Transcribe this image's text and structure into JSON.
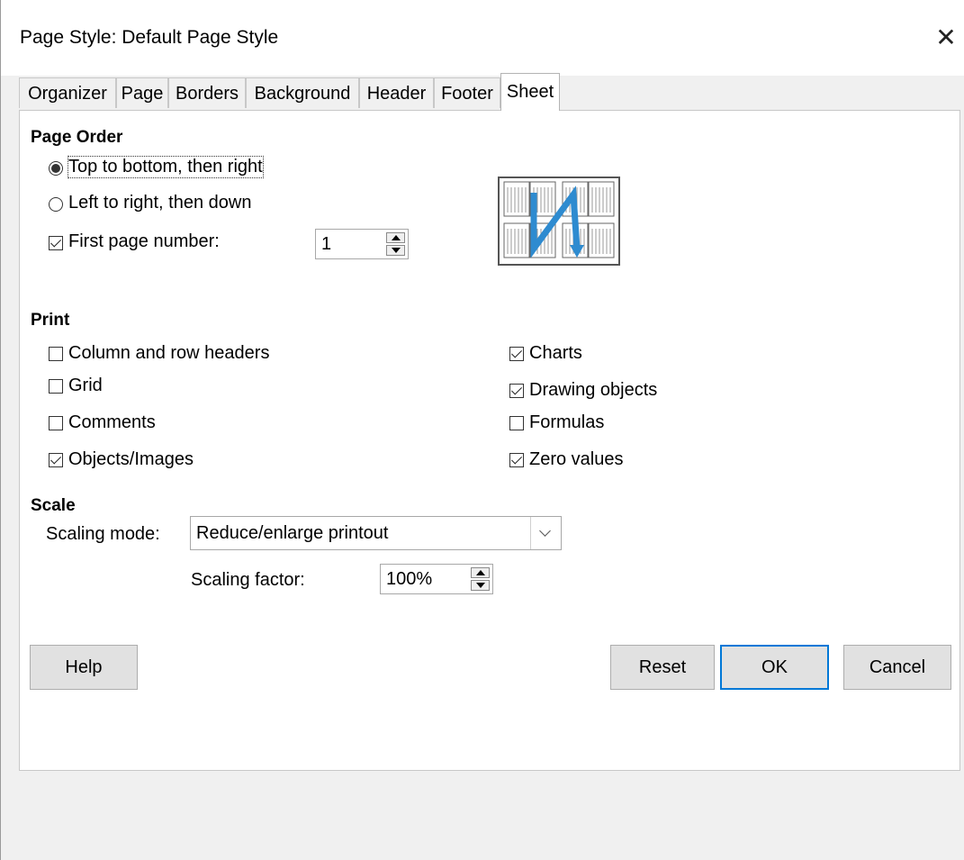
{
  "window": {
    "title": "Page Style: Default Page Style",
    "close_glyph": "✕"
  },
  "tabs": [
    {
      "label": "Organizer"
    },
    {
      "label": "Page"
    },
    {
      "label": "Borders"
    },
    {
      "label": "Background"
    },
    {
      "label": "Header"
    },
    {
      "label": "Footer"
    },
    {
      "label": "Sheet",
      "active": true
    }
  ],
  "page_order": {
    "heading": "Page Order",
    "option_top_to_bottom": "Top to bottom, then right",
    "option_left_to_right": "Left to right, then down",
    "selected": "Top to bottom, then right",
    "first_page_label": "First page number:",
    "first_page_checked": true,
    "first_page_value": "1"
  },
  "print": {
    "heading": "Print",
    "items": [
      {
        "label": "Column and row headers",
        "checked": false
      },
      {
        "label": "Grid",
        "checked": false
      },
      {
        "label": "Comments",
        "checked": false
      },
      {
        "label": "Objects/Images",
        "checked": true
      },
      {
        "label": "Charts",
        "checked": true
      },
      {
        "label": "Drawing objects",
        "checked": true
      },
      {
        "label": "Formulas",
        "checked": false
      },
      {
        "label": "Zero values",
        "checked": true
      }
    ]
  },
  "scale": {
    "heading": "Scale",
    "mode_label": "Scaling mode:",
    "mode_value": "Reduce/enlarge printout",
    "factor_label": "Scaling factor:",
    "factor_value": "100%"
  },
  "buttons": {
    "help": "Help",
    "reset": "Reset",
    "ok": "OK",
    "cancel": "Cancel"
  },
  "colors": {
    "accent": "#0078d7",
    "preview_arrow": "#2e8bd0"
  }
}
